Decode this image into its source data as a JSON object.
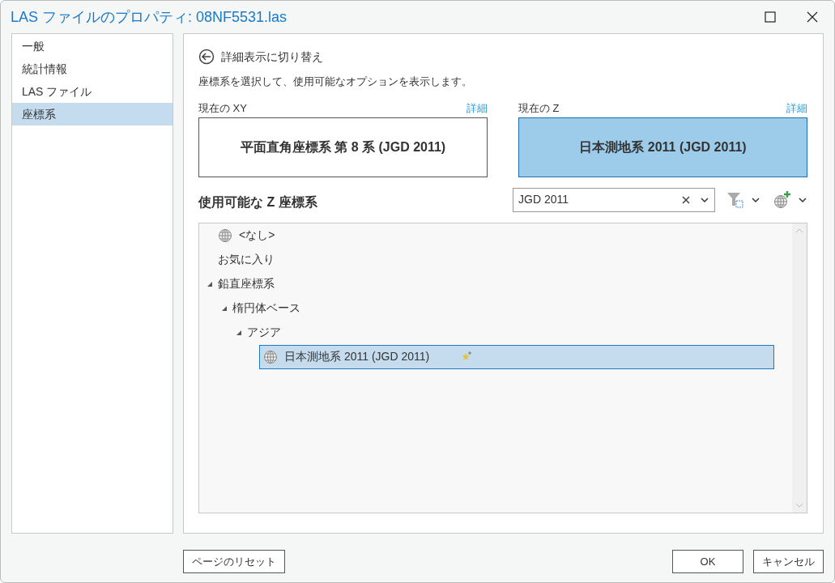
{
  "window": {
    "title": "LAS ファイルのプロパティ: 08NF5531.las"
  },
  "sidebar": {
    "items": [
      {
        "label": "一般",
        "selected": false
      },
      {
        "label": "統計情報",
        "selected": false
      },
      {
        "label": "LAS ファイル",
        "selected": false
      },
      {
        "label": "座標系",
        "selected": true
      }
    ]
  },
  "back_link": "詳細表示に切り替え",
  "instruction": "座標系を選択して、使用可能なオプションを表示します。",
  "current": [
    {
      "label": "現在の XY",
      "details": "詳細",
      "value": "平面直角座標系 第 8 系 (JGD 2011)",
      "selected": false
    },
    {
      "label": "現在の Z",
      "details": "詳細",
      "value": "日本測地系 2011 (JGD 2011)",
      "selected": true
    }
  ],
  "available_heading": "使用可能な Z 座標系",
  "search": {
    "value": "JGD 2011"
  },
  "tree": [
    {
      "label": "<なし>",
      "kind": "system",
      "selected": false,
      "favorite": false
    },
    {
      "label": "お気に入り",
      "kind": "group",
      "selected": false,
      "favorite": false
    },
    {
      "label": "鉛直座標系",
      "kind": "group",
      "expanded": true,
      "selected": false,
      "favorite": false,
      "children": [
        {
          "label": "楕円体ベース",
          "kind": "group",
          "expanded": true,
          "selected": false,
          "favorite": false,
          "children": [
            {
              "label": "アジア",
              "kind": "group",
              "expanded": true,
              "selected": false,
              "favorite": false,
              "children": [
                {
                  "label": "日本測地系 2011 (JGD 2011)",
                  "kind": "system",
                  "selected": true,
                  "favorite": true
                }
              ]
            }
          ]
        }
      ]
    }
  ],
  "footer": {
    "reset": "ページのリセット",
    "ok": "OK",
    "cancel": "キャンセル"
  }
}
